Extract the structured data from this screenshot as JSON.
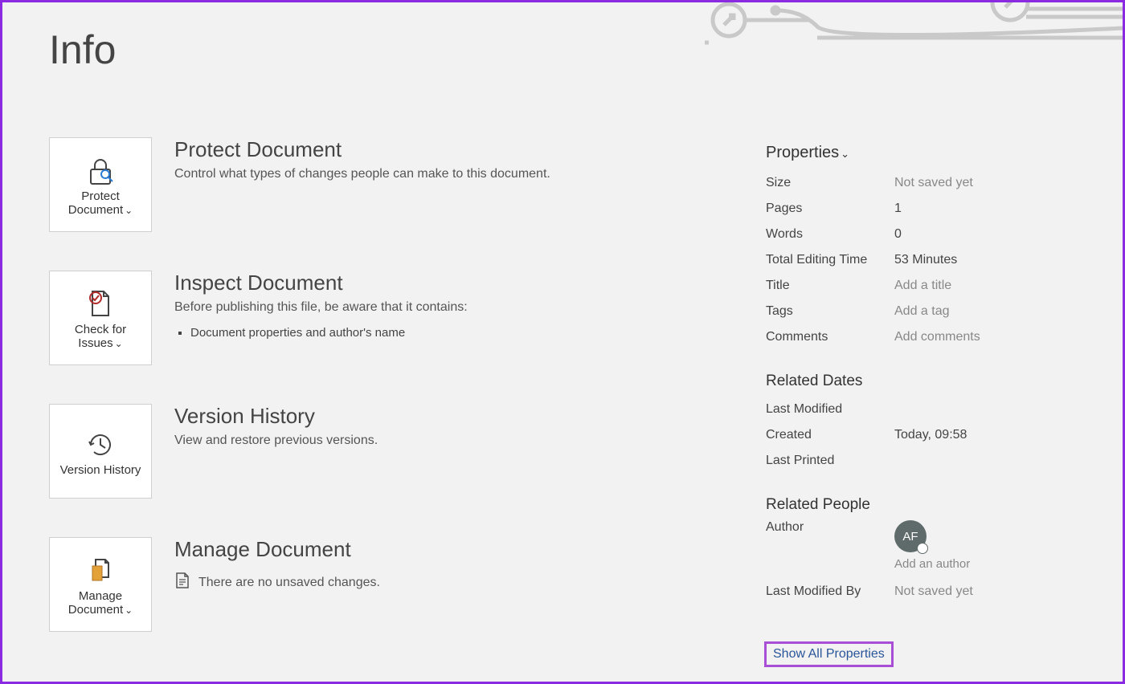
{
  "pageTitle": "Info",
  "sections": {
    "protect": {
      "tileLabel": "Protect Document",
      "heading": "Protect Document",
      "desc": "Control what types of changes people can make to this document."
    },
    "inspect": {
      "tileLabel": "Check for Issues",
      "heading": "Inspect Document",
      "desc": "Before publishing this file, be aware that it contains:",
      "bullet1": "Document properties and author's name"
    },
    "version": {
      "tileLabel": "Version History",
      "heading": "Version History",
      "desc": "View and restore previous versions."
    },
    "manage": {
      "tileLabel": "Manage Document",
      "heading": "Manage Document",
      "note": "There are no unsaved changes."
    }
  },
  "properties": {
    "heading": "Properties",
    "sizeLabel": "Size",
    "sizeValue": "Not saved yet",
    "pagesLabel": "Pages",
    "pagesValue": "1",
    "wordsLabel": "Words",
    "wordsValue": "0",
    "editTimeLabel": "Total Editing Time",
    "editTimeValue": "53 Minutes",
    "titleLabel": "Title",
    "titleValue": "Add a title",
    "tagsLabel": "Tags",
    "tagsValue": "Add a tag",
    "commentsLabel": "Comments",
    "commentsValue": "Add comments"
  },
  "relatedDates": {
    "heading": "Related Dates",
    "lastModifiedLabel": "Last Modified",
    "lastModifiedValue": "",
    "createdLabel": "Created",
    "createdValue": "Today, 09:58",
    "lastPrintedLabel": "Last Printed",
    "lastPrintedValue": ""
  },
  "relatedPeople": {
    "heading": "Related People",
    "authorLabel": "Author",
    "avatarInitials": "AF",
    "addAuthor": "Add an author",
    "lastModByLabel": "Last Modified By",
    "lastModByValue": "Not saved yet"
  },
  "showAllLink": "Show All Properties"
}
